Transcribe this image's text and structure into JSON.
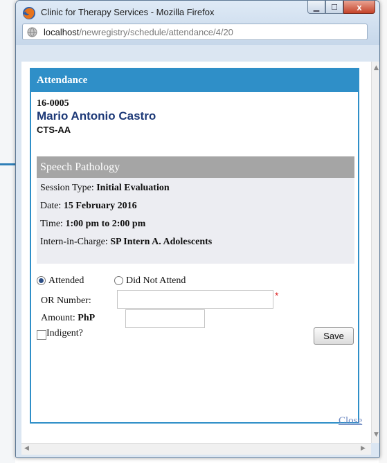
{
  "window": {
    "title": "Clinic for Therapy Services - Mozilla Firefox",
    "minimize_icon": "▁",
    "maximize_icon": "☐",
    "close_icon": "x"
  },
  "urlbar": {
    "host": "localhost",
    "path": "/newregistry/schedule/attendance/4/20"
  },
  "dialog": {
    "title": "Attendance",
    "patient_id": "16-0005",
    "patient_name": "Mario Antonio Castro",
    "patient_code": "CTS-AA",
    "service": "Speech Pathology",
    "session": {
      "type_label": "Session Type:",
      "type_value": "Initial Evaluation",
      "date_label": "Date:",
      "date_value": "15 February 2016",
      "time_label": "Time:",
      "time_value": "1:00 pm to 2:00 pm",
      "intern_label": "Intern-in-Charge:",
      "intern_value": "SP Intern A. Adolescents"
    },
    "attendance_options": {
      "attended": "Attended",
      "did_not_attend": "Did Not Attend",
      "selected": "Attended"
    },
    "or_number_label": "OR Number:",
    "or_number_value": "",
    "required_marker": "*",
    "amount_label": "Amount:",
    "amount_prefix": "PhP",
    "amount_value": "",
    "indigent_label": "Indigent?",
    "indigent_checked": false,
    "save_label": "Save"
  },
  "close_link": "Close"
}
